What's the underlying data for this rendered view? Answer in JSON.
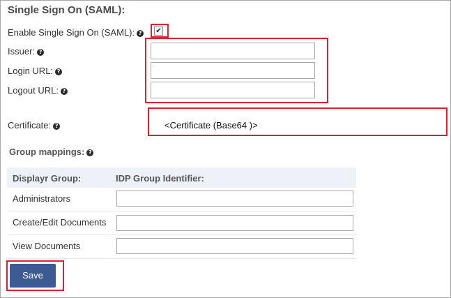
{
  "section_title": "Single Sign On (SAML):",
  "fields": {
    "enable_sso_label": "Enable Single Sign On (SAML):",
    "enable_sso_checked": true,
    "issuer_label": "Issuer:",
    "issuer_value": "",
    "login_url_label": "Login URL:",
    "login_url_value": "",
    "logout_url_label": "Logout URL:",
    "logout_url_value": "",
    "certificate_label": "Certificate:",
    "certificate_value": "<Certificate (Base64 )>"
  },
  "help_icon_glyph": "?",
  "checkbox_glyph": "✔",
  "group_mappings": {
    "title": "Group mappings:",
    "columns": [
      "Displayr Group:",
      "IDP Group Identifier:"
    ],
    "rows": [
      {
        "group": "Administrators",
        "identifier": ""
      },
      {
        "group": "Create/Edit Documents",
        "identifier": ""
      },
      {
        "group": "View Documents",
        "identifier": ""
      }
    ]
  },
  "save_label": "Save",
  "colors": {
    "highlight": "#d9232e",
    "button": "#3d5b93",
    "table_header": "#eef1f8"
  }
}
